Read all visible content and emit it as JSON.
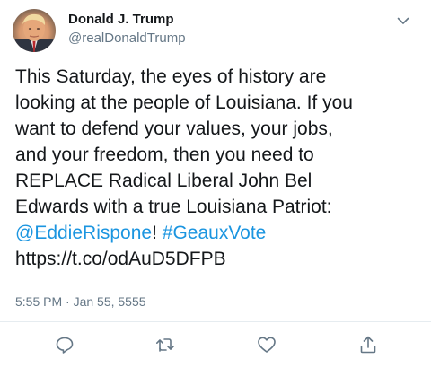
{
  "author": {
    "name": "Donald J. Trump",
    "handle": "@realDonaldTrump"
  },
  "tweet": {
    "line1": "This Saturday, the eyes of history are",
    "line2": "looking at the people of Louisiana. If you",
    "line3": "want to defend your values, your jobs,",
    "line4": "and your freedom, then you need to",
    "line5": "REPLACE Radical Liberal John Bel",
    "line6": "Edwards with a true Louisiana Patriot:",
    "mention": "@EddieRispone",
    "exclaim": "!",
    "hashtag": "#GeauxVote",
    "url": "https://t.co/odAuD5DFPB"
  },
  "meta": {
    "timestamp": "5:55 PM · Jan 55, 5555"
  },
  "icons": {
    "menu": "chevron-down-icon",
    "reply": "reply-icon",
    "retweet": "retweet-icon",
    "like": "heart-icon",
    "share": "share-icon"
  },
  "colors": {
    "text": "#14171a",
    "secondary": "#657786",
    "link": "#1b95e0"
  }
}
